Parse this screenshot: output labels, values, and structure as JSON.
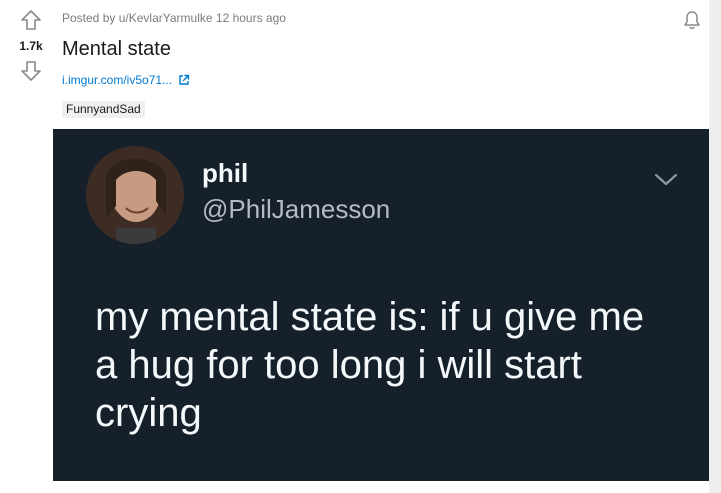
{
  "post": {
    "votes": "1.7k",
    "meta_prefix": "Posted by",
    "author": "u/KevlarYarmulke",
    "time": "12 hours ago",
    "title": "Mental state",
    "link": "i.imgur.com/iv5o71...",
    "flair": "FunnyandSad"
  },
  "tweet": {
    "name": "phil",
    "handle": "@PhilJamesson",
    "text": "my mental state is: if u give me a hug for too long i will start crying"
  },
  "icons": {
    "upvote": "upvote-arrow-icon",
    "downvote": "downvote-arrow-icon",
    "bell": "notification-bell-icon",
    "external": "external-link-icon",
    "chevron": "chevron-down-icon"
  },
  "colors": {
    "link": "#0079d3",
    "meta": "#787c7e",
    "tweet_bg": "#15202b",
    "page_bg": "#dae0e6"
  }
}
